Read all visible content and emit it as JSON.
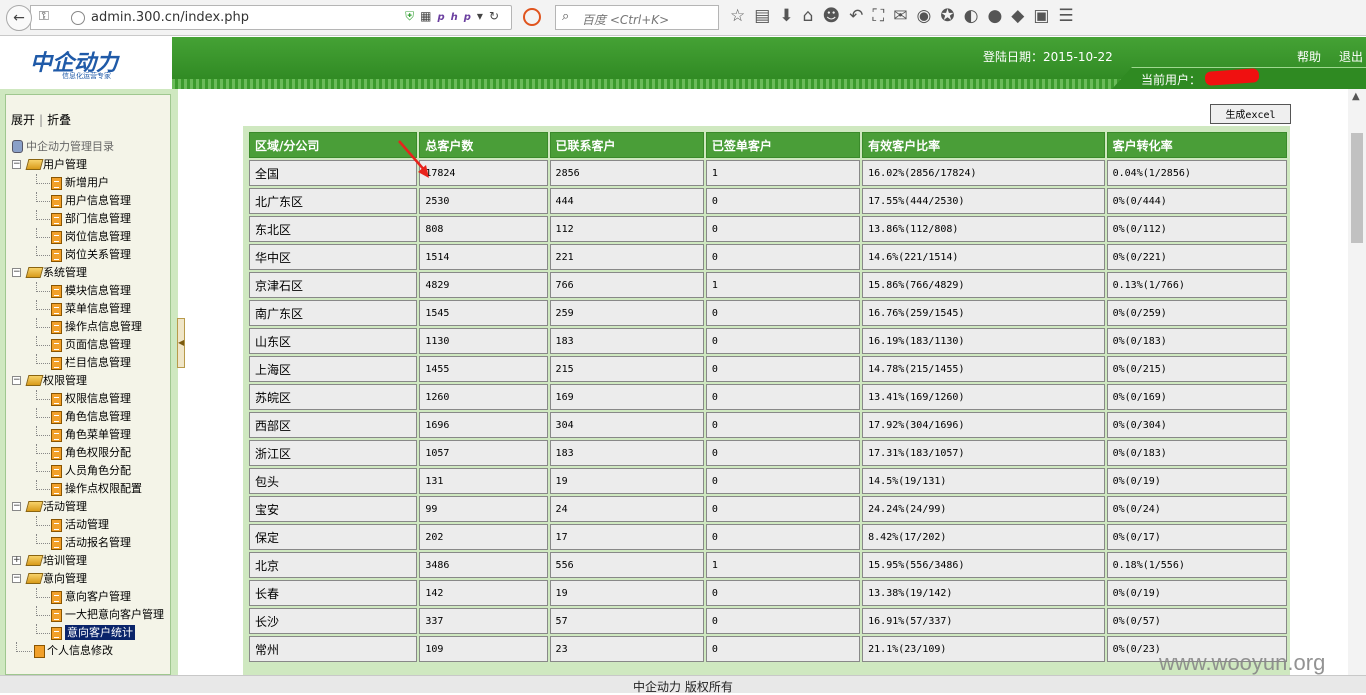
{
  "browser": {
    "url": "admin.300.cn/index.php",
    "search_placeholder": "百度 <Ctrl+K>",
    "php_badge": "php"
  },
  "header": {
    "logo_text": "中企动力",
    "logo_sub": "信息化运营专家",
    "login_date": "登陆日期：2015-10-22",
    "help": "帮助",
    "exit": "退出",
    "current_user_label": "当前用户："
  },
  "sidebar": {
    "expand": "展开",
    "collapse": "折叠",
    "root": "中企动力管理目录",
    "groups": [
      {
        "label": "用户管理",
        "items": [
          "新增用户",
          "用户信息管理",
          "部门信息管理",
          "岗位信息管理",
          "岗位关系管理"
        ]
      },
      {
        "label": "系统管理",
        "items": [
          "模块信息管理",
          "菜单信息管理",
          "操作点信息管理",
          "页面信息管理",
          "栏目信息管理"
        ]
      },
      {
        "label": "权限管理",
        "items": [
          "权限信息管理",
          "角色信息管理",
          "角色菜单管理",
          "角色权限分配",
          "人员角色分配",
          "操作点权限配置"
        ]
      },
      {
        "label": "活动管理",
        "items": [
          "活动管理",
          "活动报名管理"
        ]
      },
      {
        "label": "培训管理",
        "items": []
      },
      {
        "label": "意向管理",
        "items": [
          "意向客户管理",
          "一大把意向客户管理",
          "意向客户统计"
        ]
      }
    ],
    "personal": "个人信息修改",
    "selected": "意向客户统计"
  },
  "main": {
    "excel_button": "生成excel",
    "columns": [
      "区域/分公司",
      "总客户数",
      "已联系客户",
      "已签单客户",
      "有效客户比率",
      "客户转化率"
    ],
    "rows": [
      [
        "全国",
        "17824",
        "2856",
        "1",
        "16.02%(2856/17824)",
        "0.04%(1/2856)"
      ],
      [
        "北广东区",
        "2530",
        "444",
        "0",
        "17.55%(444/2530)",
        "0%(0/444)"
      ],
      [
        "东北区",
        "808",
        "112",
        "0",
        "13.86%(112/808)",
        "0%(0/112)"
      ],
      [
        "华中区",
        "1514",
        "221",
        "0",
        "14.6%(221/1514)",
        "0%(0/221)"
      ],
      [
        "京津石区",
        "4829",
        "766",
        "1",
        "15.86%(766/4829)",
        "0.13%(1/766)"
      ],
      [
        "南广东区",
        "1545",
        "259",
        "0",
        "16.76%(259/1545)",
        "0%(0/259)"
      ],
      [
        "山东区",
        "1130",
        "183",
        "0",
        "16.19%(183/1130)",
        "0%(0/183)"
      ],
      [
        "上海区",
        "1455",
        "215",
        "0",
        "14.78%(215/1455)",
        "0%(0/215)"
      ],
      [
        "苏皖区",
        "1260",
        "169",
        "0",
        "13.41%(169/1260)",
        "0%(0/169)"
      ],
      [
        "西部区",
        "1696",
        "304",
        "0",
        "17.92%(304/1696)",
        "0%(0/304)"
      ],
      [
        "浙江区",
        "1057",
        "183",
        "0",
        "17.31%(183/1057)",
        "0%(0/183)"
      ],
      [
        "包头",
        "131",
        "19",
        "0",
        "14.5%(19/131)",
        "0%(0/19)"
      ],
      [
        "宝安",
        "99",
        "24",
        "0",
        "24.24%(24/99)",
        "0%(0/24)"
      ],
      [
        "保定",
        "202",
        "17",
        "0",
        "8.42%(17/202)",
        "0%(0/17)"
      ],
      [
        "北京",
        "3486",
        "556",
        "1",
        "15.95%(556/3486)",
        "0.18%(1/556)"
      ],
      [
        "长春",
        "142",
        "19",
        "0",
        "13.38%(19/142)",
        "0%(0/19)"
      ],
      [
        "长沙",
        "337",
        "57",
        "0",
        "16.91%(57/337)",
        "0%(0/57)"
      ],
      [
        "常州",
        "109",
        "23",
        "0",
        "21.1%(23/109)",
        "0%(0/23)"
      ]
    ]
  },
  "footer": {
    "copyright": "中企动力 版权所有",
    "watermark": "www.wooyun.org"
  },
  "colors": {
    "header_green": "#45a235",
    "table_header": "#4a9e38",
    "cell_bg": "#ececec",
    "selected_bg": "#0a246a",
    "annotation_arrow": "#e8231c"
  }
}
